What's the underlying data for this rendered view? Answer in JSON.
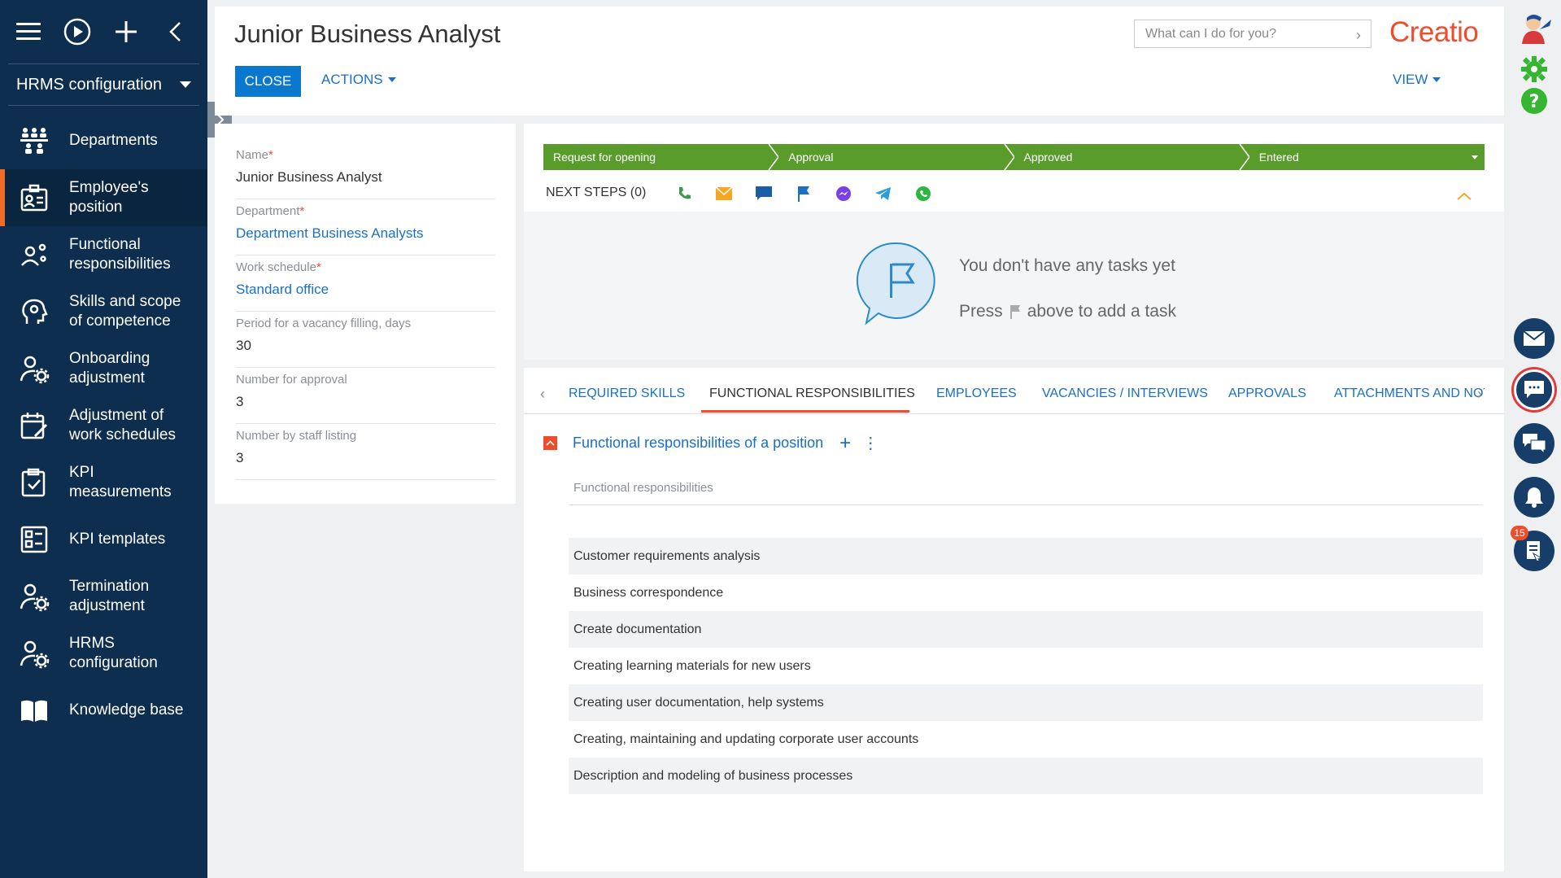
{
  "sidebar": {
    "workspace": "HRMS configuration",
    "items": [
      {
        "label": "Departments",
        "icon": "departments-icon"
      },
      {
        "label": "Employee's position",
        "icon": "position-badge-icon"
      },
      {
        "label": "Functional responsibilities",
        "icon": "person-gear-icon"
      },
      {
        "label": "Skills and scope of competence",
        "icon": "head-gear-icon"
      },
      {
        "label": "Onboarding adjustment",
        "icon": "person-gear-icon"
      },
      {
        "label": "Adjustment of work schedules",
        "icon": "calendar-edit-icon"
      },
      {
        "label": "KPI measurements",
        "icon": "clipboard-check-icon"
      },
      {
        "label": "KPI templates",
        "icon": "template-icon"
      },
      {
        "label": "Termination adjustment",
        "icon": "person-gear-icon"
      },
      {
        "label": "HRMS configuration",
        "icon": "person-gear-icon"
      },
      {
        "label": "Knowledge base",
        "icon": "book-icon"
      }
    ]
  },
  "header": {
    "title": "Junior Business Analyst",
    "close_label": "CLOSE",
    "actions_label": "ACTIONS",
    "view_label": "VIEW",
    "search_placeholder": "What can I do for you?",
    "logo_text": "Creatio"
  },
  "fields": {
    "name": {
      "label": "Name",
      "value": "Junior Business Analyst",
      "required": true
    },
    "department": {
      "label": "Department",
      "value": "Department Business Analysts",
      "required": true
    },
    "work_schedule": {
      "label": "Work schedule",
      "value": "Standard office",
      "required": true
    },
    "vacancy_period": {
      "label": "Period for a vacancy filling, days",
      "value": "30"
    },
    "number_for_approval": {
      "label": "Number for approval",
      "value": "3"
    },
    "number_by_staff": {
      "label": "Number by staff listing",
      "value": "3"
    }
  },
  "stages": [
    "Request for opening",
    "Approval",
    "Approved",
    "Entered"
  ],
  "next_steps": {
    "label": "NEXT STEPS (0)",
    "empty_title": "You don't have any tasks yet",
    "empty_press": "Press",
    "empty_suffix": "above to add a task"
  },
  "tabs": [
    "REQUIRED SKILLS",
    "FUNCTIONAL RESPONSIBILITIES",
    "EMPLOYEES",
    "VACANCIES / INTERVIEWS",
    "APPROVALS",
    "ATTACHMENTS AND NOTES"
  ],
  "active_tab": "FUNCTIONAL RESPONSIBILITIES",
  "detail": {
    "title": "Functional responsibilities of a position",
    "column": "Functional responsibilities",
    "rows": [
      "Customer requirements analysis",
      "Business correspondence",
      "Create documentation",
      "Creating learning materials for new users",
      "Creating user documentation, help systems",
      "Creating, maintaining and updating corporate user accounts",
      "Description and modeling of business processes"
    ]
  },
  "rail": {
    "notification_count": "15"
  },
  "colors": {
    "sidebar": "#0d2e4e",
    "accent": "#ef4c2c",
    "link": "#1a70c5",
    "stage": "#5a9c2c",
    "primary_button": "#0b78d0"
  }
}
